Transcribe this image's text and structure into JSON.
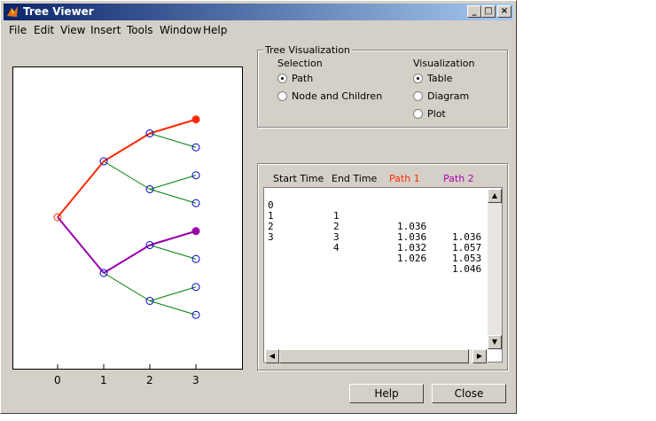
{
  "window": {
    "title": "Tree Viewer"
  },
  "menu": [
    "File",
    "Edit",
    "View",
    "Insert",
    "Tools",
    "Window",
    "Help"
  ],
  "title_buttons": {
    "minimize": "_",
    "maximize": "□",
    "close": "×"
  },
  "tree_viz": {
    "legend": "Tree Visualization",
    "selection": {
      "heading": "Selection",
      "options": [
        "Path",
        "Node and Children"
      ],
      "selected": "Path"
    },
    "visualization": {
      "heading": "Visualization",
      "options": [
        "Table",
        "Diagram",
        "Plot"
      ],
      "selected": "Table"
    }
  },
  "table": {
    "headers": [
      "Start Time",
      "End Time",
      "Path 1",
      "Path 2"
    ],
    "header_colors": [
      "#000000",
      "#000000",
      "#ff2a00",
      "#b000b0"
    ],
    "rows": [
      [
        "0",
        "1",
        "1.036",
        "1.036"
      ],
      [
        "1",
        "2",
        "1.036",
        "1.057"
      ],
      [
        "2",
        "3",
        "1.032",
        "1.053"
      ],
      [
        "3",
        "4",
        "1.026",
        "1.046"
      ]
    ]
  },
  "chart_data": {
    "type": "line",
    "x_ticks": [
      "0",
      "1",
      "2",
      "3"
    ],
    "nodes": [
      {
        "t": 0,
        "y": 0
      },
      {
        "t": 1,
        "y": 1
      },
      {
        "t": 1,
        "y": -1
      },
      {
        "t": 2,
        "y": 1.5
      },
      {
        "t": 2,
        "y": 0.5
      },
      {
        "t": 2,
        "y": -0.5
      },
      {
        "t": 2,
        "y": -1.5
      },
      {
        "t": 3,
        "y": 1.75
      },
      {
        "t": 3,
        "y": 1.25
      },
      {
        "t": 3,
        "y": 0.75
      },
      {
        "t": 3,
        "y": 0.25
      },
      {
        "t": 3,
        "y": -0.25
      },
      {
        "t": 3,
        "y": -0.75
      },
      {
        "t": 3,
        "y": -1.25
      },
      {
        "t": 3,
        "y": -1.75
      }
    ],
    "edges": [
      [
        0,
        1
      ],
      [
        0,
        2
      ],
      [
        1,
        3
      ],
      [
        1,
        4
      ],
      [
        2,
        5
      ],
      [
        2,
        6
      ],
      [
        3,
        7
      ],
      [
        3,
        8
      ],
      [
        4,
        9
      ],
      [
        4,
        10
      ],
      [
        5,
        11
      ],
      [
        5,
        12
      ],
      [
        6,
        13
      ],
      [
        6,
        14
      ]
    ],
    "path1": [
      0,
      1,
      3,
      7
    ],
    "path2": [
      0,
      2,
      5,
      11
    ],
    "colors": {
      "tree": "#008000",
      "node": "#0000cc",
      "path1": "#ff2a00",
      "path2": "#9900aa"
    }
  },
  "buttons": {
    "help": "Help",
    "close": "Close"
  }
}
